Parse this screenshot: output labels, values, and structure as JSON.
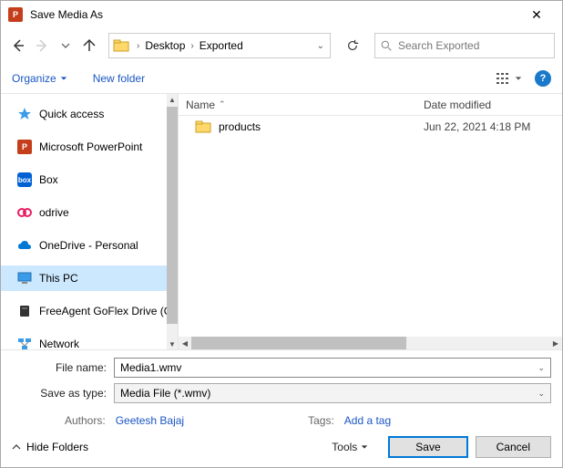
{
  "titlebar": {
    "title": "Save Media As"
  },
  "nav": {
    "crumbs": [
      "Desktop",
      "Exported"
    ],
    "search_placeholder": "Search Exported"
  },
  "toolbar": {
    "organize": "Organize",
    "newfolder": "New folder"
  },
  "sidebar": {
    "items": [
      {
        "label": "Quick access"
      },
      {
        "label": "Microsoft PowerPoint"
      },
      {
        "label": "Box"
      },
      {
        "label": "odrive"
      },
      {
        "label": "OneDrive - Personal"
      },
      {
        "label": "This PC"
      },
      {
        "label": "FreeAgent GoFlex Drive (G"
      },
      {
        "label": "Network"
      }
    ]
  },
  "columns": {
    "name": "Name",
    "date": "Date modified"
  },
  "files": [
    {
      "name": "products",
      "date": "Jun 22, 2021 4:18 PM"
    }
  ],
  "form": {
    "filename_label": "File name:",
    "filename_value": "Media1.wmv",
    "savetype_label": "Save as type:",
    "savetype_value": "Media File (*.wmv)"
  },
  "meta": {
    "authors_label": "Authors:",
    "authors_value": "Geetesh Bajaj",
    "tags_label": "Tags:",
    "tags_value": "Add a tag"
  },
  "buttons": {
    "hidefolders": "Hide Folders",
    "tools": "Tools",
    "save": "Save",
    "cancel": "Cancel"
  }
}
